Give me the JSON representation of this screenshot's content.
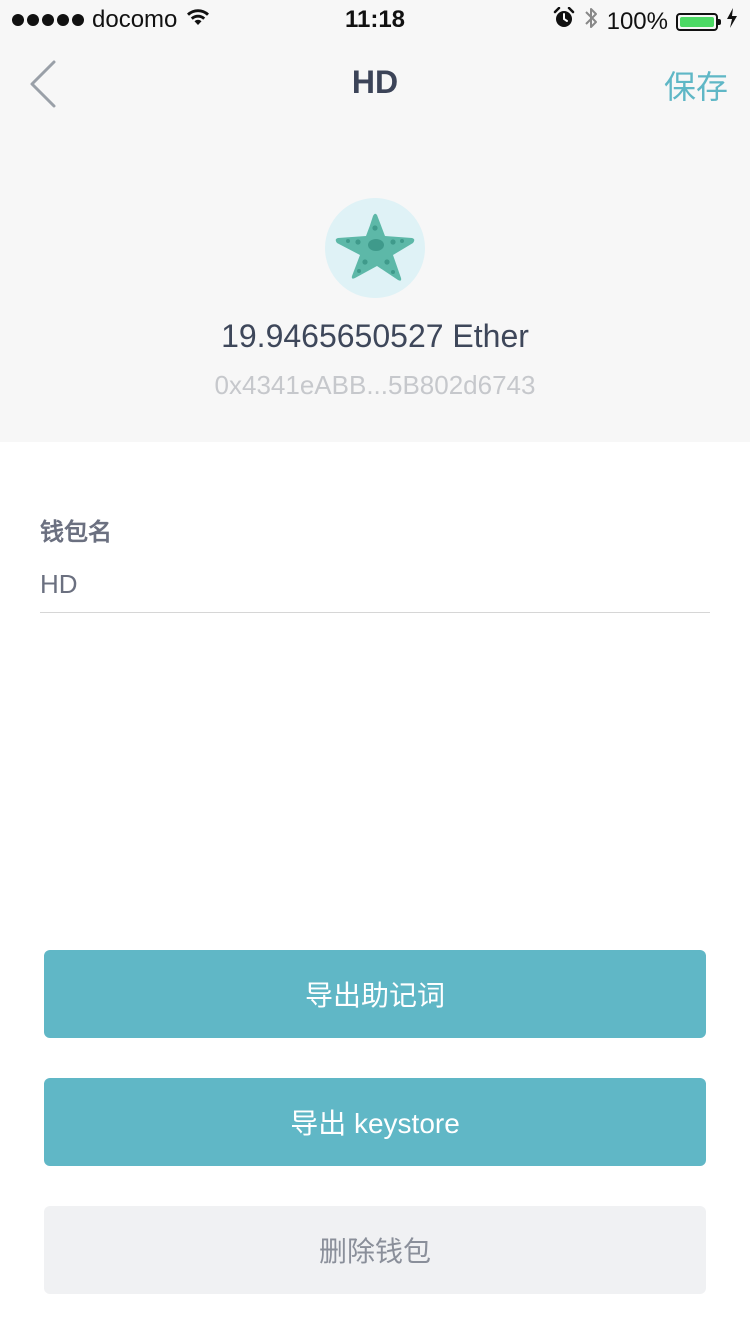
{
  "status_bar": {
    "carrier": "docomo",
    "time": "11:18",
    "battery": "100%"
  },
  "nav": {
    "title": "HD",
    "save_label": "保存"
  },
  "wallet": {
    "balance": "19.9465650527 Ether",
    "address": "0x4341eABB...5B802d6743",
    "name_label": "钱包名",
    "name_value": "HD"
  },
  "actions": {
    "export_mnemonic": "导出助记词",
    "export_keystore": "导出 keystore",
    "delete_wallet": "删除钱包"
  },
  "icons": {
    "back": "chevron-left-icon",
    "avatar": "starfish-icon",
    "wifi": "wifi-icon",
    "alarm": "alarm-icon",
    "bluetooth": "bluetooth-icon",
    "battery": "battery-icon",
    "charging": "charging-bolt-icon"
  },
  "colors": {
    "accent": "#60b7c6",
    "battery_fill": "#4cd964"
  }
}
